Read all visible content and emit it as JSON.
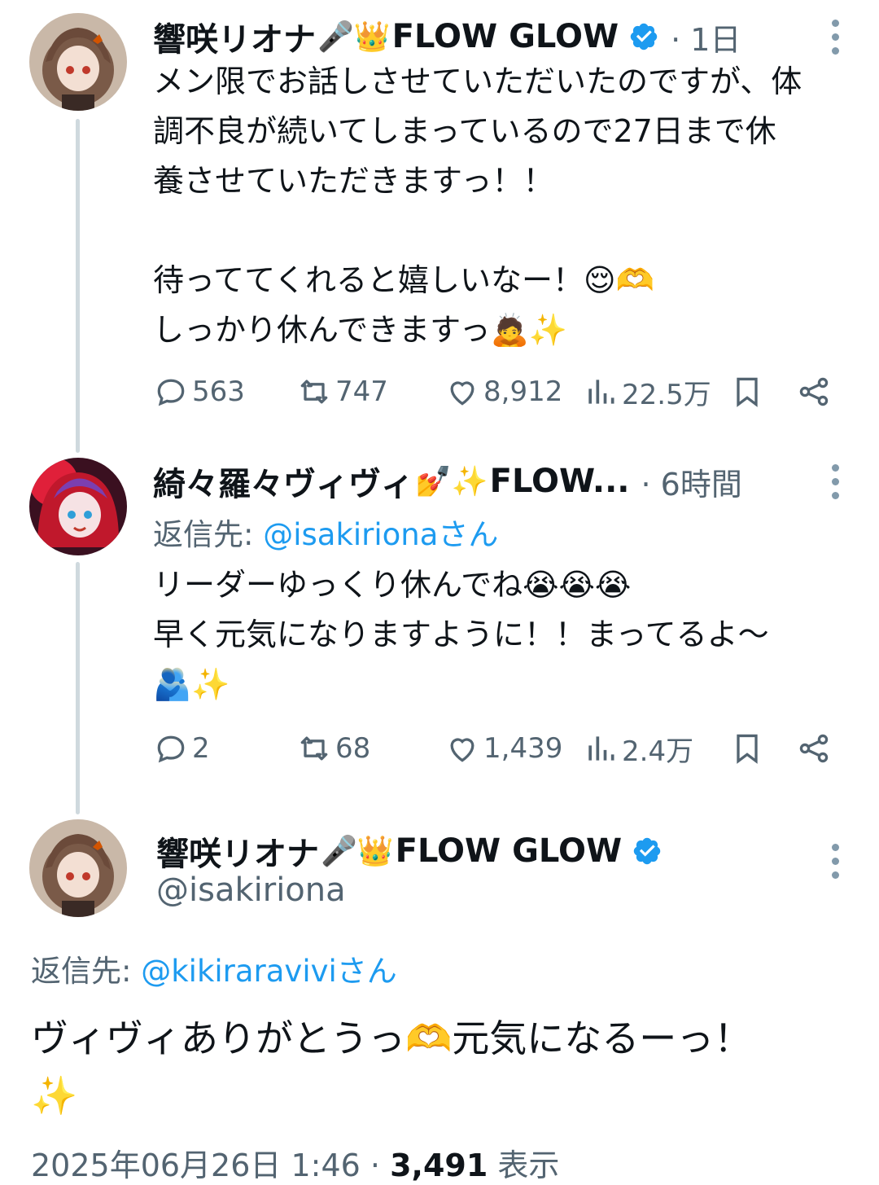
{
  "colors": {
    "accent": "#1d9bf0",
    "muted": "#536471",
    "text": "#0f1419",
    "thread_line": "#cfd9de"
  },
  "tweet1": {
    "name": "響咲リオナ",
    "name_emojis": "🎤👑",
    "name_suffix": "FLOW GLOW",
    "time": "· 1日",
    "body": "メン限でお話しさせていただいたのですが、体調不良が続いてしまっているので27日まで休養させていただきますっ！！\n\n待っててくれると嬉しいなー！😌🫶\nしっかり休んできますっ🙇✨",
    "replies": "563",
    "retweets": "747",
    "likes": "8,912",
    "views": "22.5万"
  },
  "tweet2": {
    "name": "綺々羅々ヴィヴィ",
    "name_emojis": "💅✨",
    "name_suffix": "FLOW...",
    "time": "· 6時間",
    "reply_prefix": "返信先: ",
    "reply_handle": "@isakirionaさん",
    "body": "リーダーゆっくり休んでね😭😭😭\n早く元気になりますように！！まってるよ〜🫂✨",
    "replies": "2",
    "retweets": "68",
    "likes": "1,439",
    "views": "2.4万"
  },
  "main_tweet": {
    "name": "響咲リオナ",
    "name_emojis": "🎤👑",
    "name_suffix": "FLOW GLOW",
    "handle": "@isakiriona",
    "reply_prefix": "返信先: ",
    "reply_handle": "@kikiraraviviさん",
    "body": "ヴィヴィありがとうっ🫶元気になるーっ！\n✨",
    "timestamp": "2025年06月26日 1:46 · ",
    "view_count": "3,491",
    "view_label": " 表示"
  }
}
